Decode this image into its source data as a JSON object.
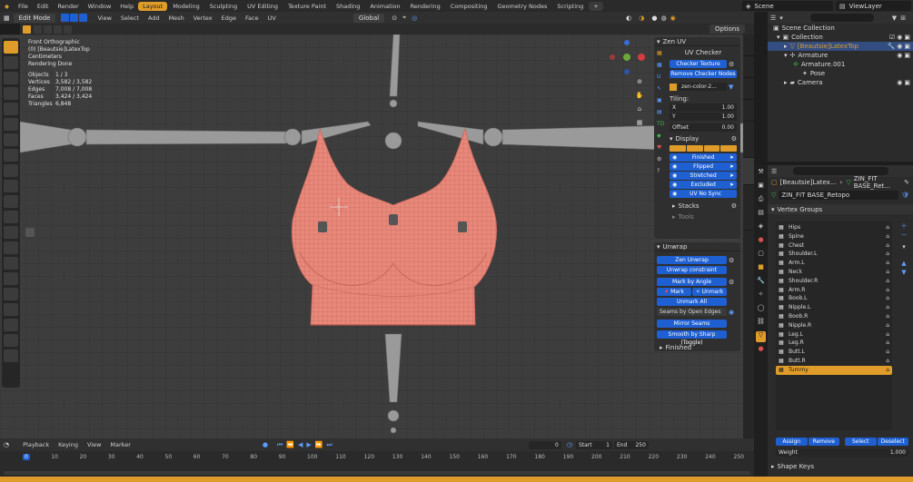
{
  "topbar": {
    "menus": [
      "File",
      "Edit",
      "Render",
      "Window",
      "Help"
    ],
    "workspaces": [
      "Layout",
      "Modeling",
      "Sculpting",
      "UV Editing",
      "Texture Paint",
      "Shading",
      "Animation",
      "Rendering",
      "Compositing",
      "Geometry Nodes",
      "Scripting"
    ],
    "active_workspace": "Layout",
    "scene": "Scene",
    "view_layer": "ViewLayer"
  },
  "header": {
    "mode": "Edit Mode",
    "menus": [
      "View",
      "Select",
      "Add",
      "Mesh",
      "Vertex",
      "Edge",
      "Face",
      "UV"
    ],
    "transform": "Global",
    "options": "Options"
  },
  "viewport_info": {
    "view": "Front Orthographic",
    "object": "(0) [Beautsie]LatexTop",
    "units": "Centimeters",
    "status": "Rendering Done",
    "stats": [
      {
        "label": "Objects",
        "value": "1 / 3"
      },
      {
        "label": "Vertices",
        "value": "3,582 / 3,582"
      },
      {
        "label": "Edges",
        "value": "7,008 / 7,008"
      },
      {
        "label": "Faces",
        "value": "3,424 / 3,424"
      },
      {
        "label": "Triangles",
        "value": "6,848"
      }
    ]
  },
  "zen_uv": {
    "title": "Zen UV",
    "checker_title": "UV Checker",
    "checker_texture": "Checker Texture",
    "remove_checker": "Remove Checker Nodes",
    "texture_name": "zen-color-2...",
    "tiling_label": "Tiling:",
    "tiling_x": {
      "label": "X",
      "value": "1.00"
    },
    "tiling_y": {
      "label": "Y",
      "value": "1.00"
    },
    "offset": {
      "label": "Offset",
      "value": "0.00"
    },
    "display_label": "Display",
    "display_toggles": [
      "Finished",
      "Flipped",
      "Stretched",
      "Excluded",
      "UV No Sync"
    ],
    "stacks": "Stacks",
    "tools": "Tools"
  },
  "unwrap": {
    "title": "Unwrap",
    "zen_unwrap": "Zen Unwrap",
    "unwrap_constraint": "Unwrap constraint",
    "mark_by_angle": "Mark by Angle",
    "mark": "Mark",
    "unmark": "Unmark",
    "unmark_all": "Unmark All",
    "seams_open_edges": "Seams by Open Edges",
    "mirror_seams": "Mirror Seams",
    "smooth_by_sharp": "Smooth by Sharp (Toggle)",
    "finished": "Finished"
  },
  "outliner": {
    "items": [
      {
        "label": "Scene Collection",
        "indent": 0
      },
      {
        "label": "Collection",
        "indent": 1
      },
      {
        "label": "[Beautsie]LatexTop",
        "indent": 2,
        "selected": true
      },
      {
        "label": "Armature",
        "indent": 2
      },
      {
        "label": "Armature.001",
        "indent": 3
      },
      {
        "label": "Pose",
        "indent": 4
      },
      {
        "label": "Camera",
        "indent": 2
      }
    ]
  },
  "properties": {
    "breadcrumb_object": "[Beautsie]Latex...",
    "breadcrumb_mesh": "ZIN_FIT BASE_Ret...",
    "mesh_name": "ZIN_FIT BASE_Retopo",
    "vertex_groups_title": "Vertex Groups",
    "vertex_groups": [
      "Hips",
      "Spine",
      "Chest",
      "Shoulder.L",
      "Arm.L",
      "Neck",
      "Shoulder.R",
      "Arm.R",
      "Boob.L",
      "Nipple.L",
      "Boob.R",
      "Nipple.R",
      "Leg.L",
      "Leg.R",
      "Butt.L",
      "Butt.R",
      "Tummy"
    ],
    "selected_group": "Tummy",
    "assign": "Assign",
    "remove": "Remove",
    "select": "Select",
    "deselect": "Deselect",
    "weight_label": "Weight",
    "weight_value": "1.000",
    "shape_keys": "Shape Keys"
  },
  "timeline": {
    "menus": [
      "Playback",
      "Keying",
      "View",
      "Marker"
    ],
    "current_frame": "0",
    "start_label": "Start",
    "start_value": "1",
    "end_label": "End",
    "end_value": "250",
    "ticks": [
      "0",
      "10",
      "20",
      "30",
      "40",
      "50",
      "60",
      "70",
      "80",
      "90",
      "100",
      "110",
      "120",
      "130",
      "140",
      "150",
      "160",
      "170",
      "180",
      "190",
      "200",
      "210",
      "220",
      "230",
      "240",
      "250"
    ]
  },
  "colors": {
    "accent": "#e09c2a",
    "blue": "#1e5fd2",
    "mesh": "#e8887a"
  }
}
